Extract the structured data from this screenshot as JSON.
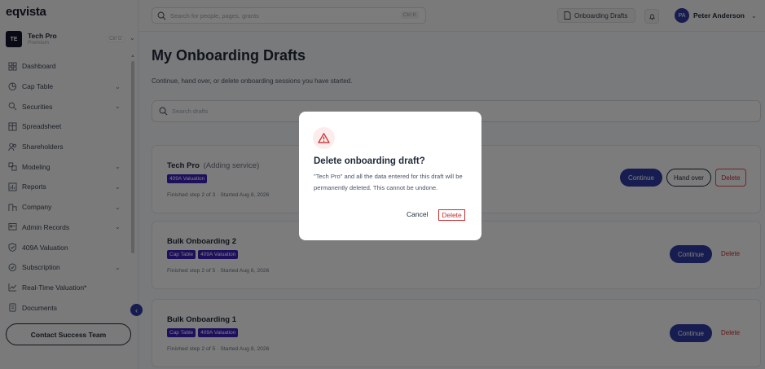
{
  "app": {
    "logo": "eqvista"
  },
  "org": {
    "initials": "TE",
    "name": "Tech Pro",
    "plan": "Premium",
    "shortcut": "Ctrl O"
  },
  "sidebar": {
    "items": [
      {
        "label": "Dashboard",
        "icon": "dashboard-icon",
        "chevron": false
      },
      {
        "label": "Cap Table",
        "icon": "pie-chart-icon",
        "chevron": true
      },
      {
        "label": "Securities",
        "icon": "securities-icon",
        "chevron": true
      },
      {
        "label": "Spreadsheet",
        "icon": "spreadsheet-icon",
        "chevron": false
      },
      {
        "label": "Shareholders",
        "icon": "users-icon",
        "chevron": false
      },
      {
        "label": "Modeling",
        "icon": "modeling-icon",
        "chevron": true
      },
      {
        "label": "Reports",
        "icon": "reports-icon",
        "chevron": true
      },
      {
        "label": "Company",
        "icon": "company-icon",
        "chevron": true
      },
      {
        "label": "Admin Records",
        "icon": "admin-icon",
        "chevron": true
      },
      {
        "label": "409A Valuation",
        "icon": "shield-icon",
        "chevron": false
      },
      {
        "label": "Subscription",
        "icon": "subscription-icon",
        "chevron": true
      },
      {
        "label": "Real-Time Valuation*",
        "icon": "trend-icon",
        "chevron": false
      },
      {
        "label": "Documents",
        "icon": "documents-icon",
        "chevron": false
      }
    ],
    "contact_label": "Contact Success Team"
  },
  "topbar": {
    "search_placeholder": "Search for people, pages, grants",
    "search_shortcut": "Ctrl K",
    "drafts_label": "Onboarding Drafts",
    "user_initials": "PA",
    "user_name": "Peter Anderson"
  },
  "main": {
    "title": "My Onboarding Drafts",
    "subtitle": "Continue, hand over, or delete onboarding sessions you have started.",
    "search_placeholder": "Search drafts",
    "cards": [
      {
        "title": "Tech Pro",
        "note": "(Adding service)",
        "tags": [
          "409A Valuation"
        ],
        "meta": "Finished step 2 of 3 · Started Aug 8, 2026",
        "continue": "Continue",
        "handover": "Hand over",
        "delete": "Delete"
      },
      {
        "title": "Bulk Onboarding 2",
        "note": "",
        "tags": [
          "Cap Table",
          "409A Valuation"
        ],
        "meta": "Finished step 2 of 5 · Started Aug 8, 2026",
        "continue": "Continue",
        "delete": "Delete"
      },
      {
        "title": "Bulk Onboarding 1",
        "note": "",
        "tags": [
          "Cap Table",
          "409A Valuation"
        ],
        "meta": "Finished step 2 of 5 · Started Aug 8, 2026",
        "continue": "Continue",
        "delete": "Delete"
      }
    ]
  },
  "modal": {
    "title": "Delete onboarding draft?",
    "body": "\"Tech Pro\" and all the data entered for this draft will be permanently deleted. This cannot be undone.",
    "cancel": "Cancel",
    "delete": "Delete"
  },
  "colors": {
    "accent": "#2e3ba0",
    "tag": "#3b1fb8",
    "danger": "#c53030"
  }
}
